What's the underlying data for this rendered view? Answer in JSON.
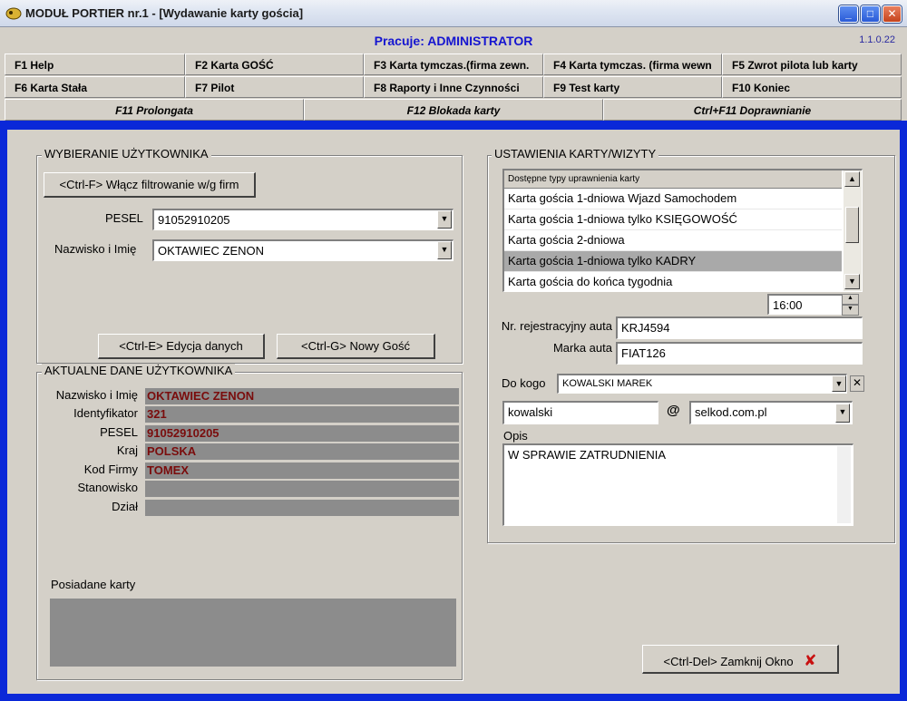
{
  "window": {
    "title": "MODUŁ PORTIER nr.1 - [Wydawanie karty gościa]",
    "minimize_icon": "minimize-icon",
    "maximize_icon": "maximize-icon",
    "close_icon": "close-icon"
  },
  "header": {
    "user_status": "Pracuje: ADMINISTRATOR",
    "version": "1.1.0.22"
  },
  "function_keys": {
    "row1": [
      "F1 Help",
      "F2 Karta GOŚĆ",
      "F3 Karta tymczas.(firma zewn.",
      "F4 Karta tymczas. (firma wewn",
      "F5 Zwrot pilota lub karty"
    ],
    "row2": [
      "F6 Karta Stała",
      "F7  Pilot",
      "F8 Raporty i Inne Czynności",
      "F9 Test karty",
      "F10  Koniec"
    ],
    "row3": [
      "F11 Prolongata",
      "F12 Blokada karty",
      "Ctrl+F11  Doprawnianie"
    ]
  },
  "select_user": {
    "legend": "WYBIERANIE UŻYTKOWNIKA",
    "filter_button": "<Ctrl-F>  Włącz filtrowanie w/g firm",
    "pesel_label": "PESEL",
    "pesel_value": "91052910205",
    "name_label": "Nazwisko i Imię",
    "name_value": "OKTAWIEC ZENON",
    "edit_button": "<Ctrl-E> Edycja danych",
    "new_guest_button": "<Ctrl-G> Nowy Gość"
  },
  "current_user": {
    "legend": "AKTUALNE DANE UŻYTKOWNIKA",
    "fields": [
      {
        "label": "Nazwisko i Imię",
        "value": "OKTAWIEC ZENON"
      },
      {
        "label": "Identyfikator",
        "value": "321"
      },
      {
        "label": "PESEL",
        "value": "91052910205"
      },
      {
        "label": "Kraj",
        "value": "POLSKA"
      },
      {
        "label": "Kod Firmy",
        "value": "TOMEX"
      },
      {
        "label": "Stanowisko",
        "value": ""
      },
      {
        "label": "Dział",
        "value": ""
      }
    ],
    "cards_label": "Posiadane karty"
  },
  "card_settings": {
    "legend": "USTAWIENIA KARTY/WIZYTY",
    "list_header": "Dostępne typy uprawnienia karty",
    "list_items": [
      "Karta gościa 1-dniowa Wjazd Samochodem",
      "Karta gościa 1-dniowa tylko KSIĘGOWOŚĆ",
      "Karta gościa 2-dniowa",
      "Karta gościa 1-dniowa tylko KADRY",
      "Karta gościa do końca tygodnia"
    ],
    "selected_index": 3,
    "time_value": "16:00",
    "plate_label": "Nr. rejestracyjny auta",
    "plate_value": "KRJ4594",
    "car_make_label": "Marka auta",
    "car_make_value": "FIAT126",
    "to_whom_label": "Do kogo",
    "to_whom_value": "KOWALSKI MAREK",
    "email_user": "kowalski",
    "email_at": "@",
    "email_domain": "selkod.com.pl",
    "description_label": "Opis",
    "description_value": "W SPRAWIE ZATRUDNIENIA"
  },
  "footer": {
    "close_button": "<Ctrl-Del> Zamknij Okno"
  },
  "colors": {
    "frame_blue": "#0a28d8",
    "user_status": "#1515d0",
    "data_value": "#7a0c0c",
    "close_x": "#c81010"
  }
}
